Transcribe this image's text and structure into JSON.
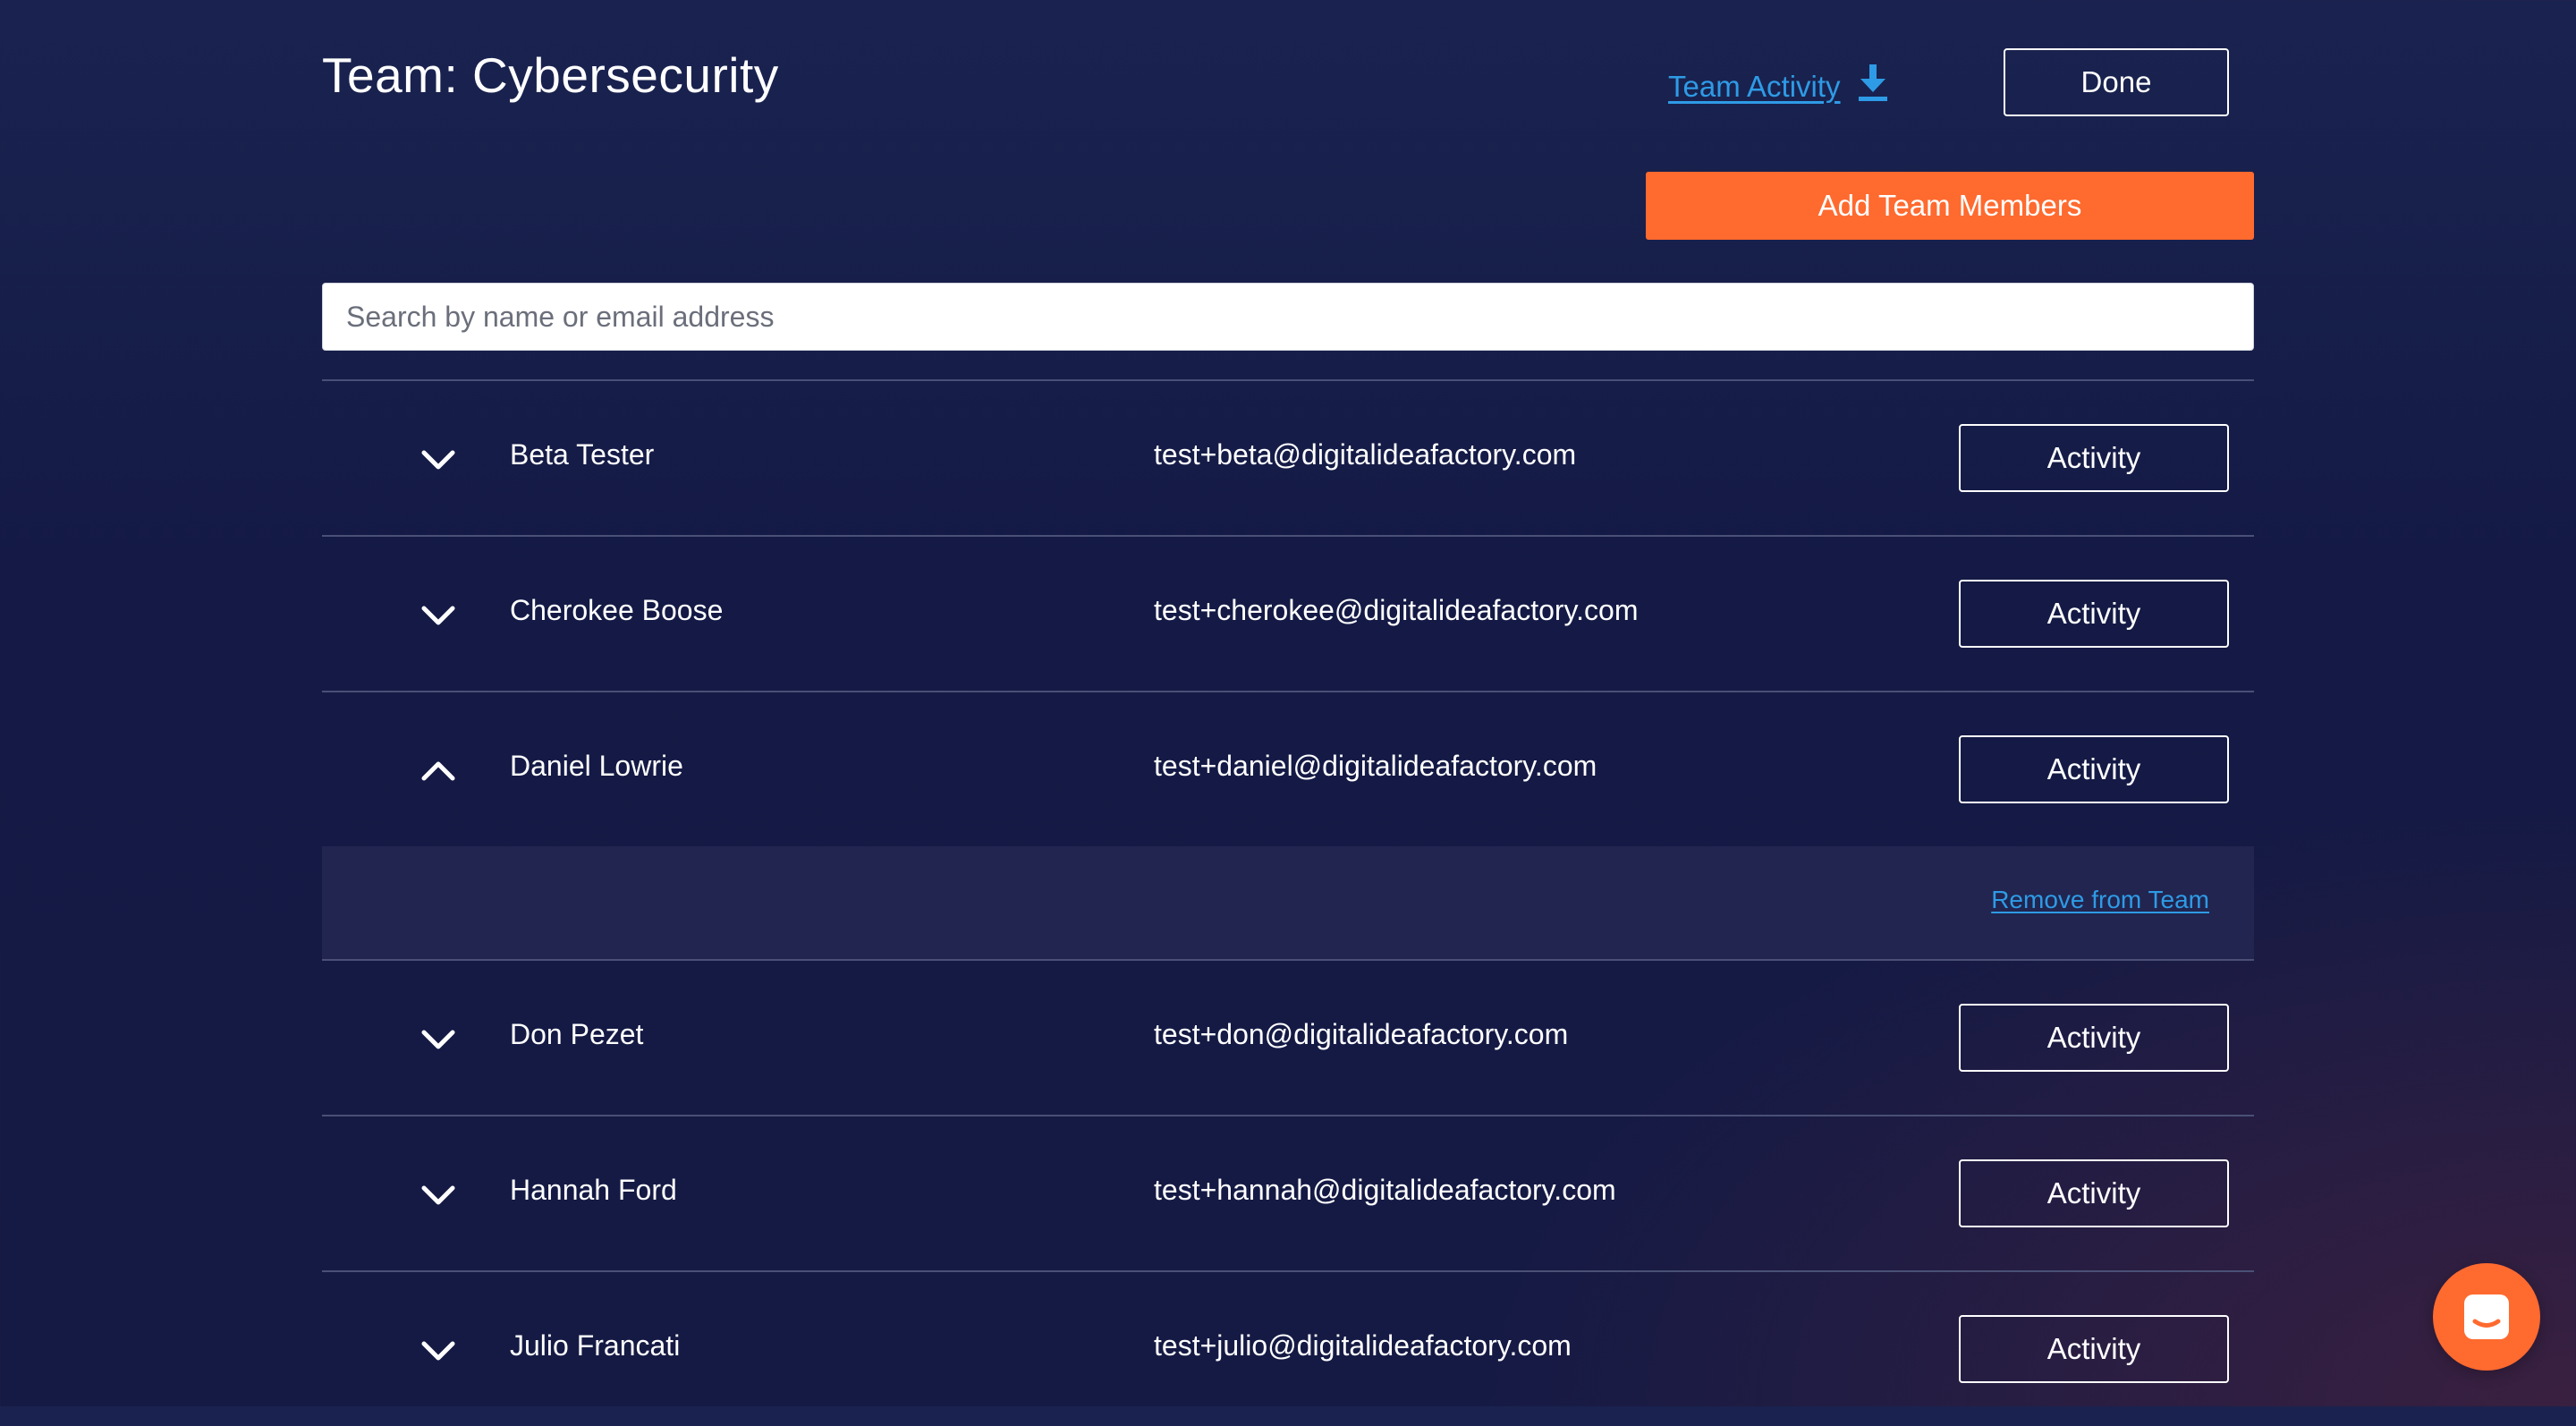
{
  "header": {
    "title": "Team: Cybersecurity",
    "team_activity_label": "Team Activity",
    "done_label": "Done",
    "add_members_label": "Add Team Members"
  },
  "search": {
    "placeholder": "Search by name or email address",
    "value": ""
  },
  "members": [
    {
      "name": "Beta Tester",
      "email": "test+beta@digitalideafactory.com",
      "activity_label": "Activity",
      "expanded": false
    },
    {
      "name": "Cherokee Boose",
      "email": "test+cherokee@digitalideafactory.com",
      "activity_label": "Activity",
      "expanded": false
    },
    {
      "name": "Daniel Lowrie",
      "email": "test+daniel@digitalideafactory.com",
      "activity_label": "Activity",
      "expanded": true
    },
    {
      "name": "Don Pezet",
      "email": "test+don@digitalideafactory.com",
      "activity_label": "Activity",
      "expanded": false
    },
    {
      "name": "Hannah Ford",
      "email": "test+hannah@digitalideafactory.com",
      "activity_label": "Activity",
      "expanded": false
    },
    {
      "name": "Julio Francati",
      "email": "test+julio@digitalideafactory.com",
      "activity_label": "Activity",
      "expanded": false
    }
  ],
  "expanded_panel": {
    "remove_label": "Remove from Team"
  },
  "icons": {
    "download": "download-icon",
    "chevron_down": "chevron-down-icon",
    "chevron_up": "chevron-up-icon",
    "chat": "chat-icon"
  },
  "colors": {
    "accent_orange": "#ff6a2f",
    "link_blue": "#2e9be6",
    "background": "#141a45"
  }
}
